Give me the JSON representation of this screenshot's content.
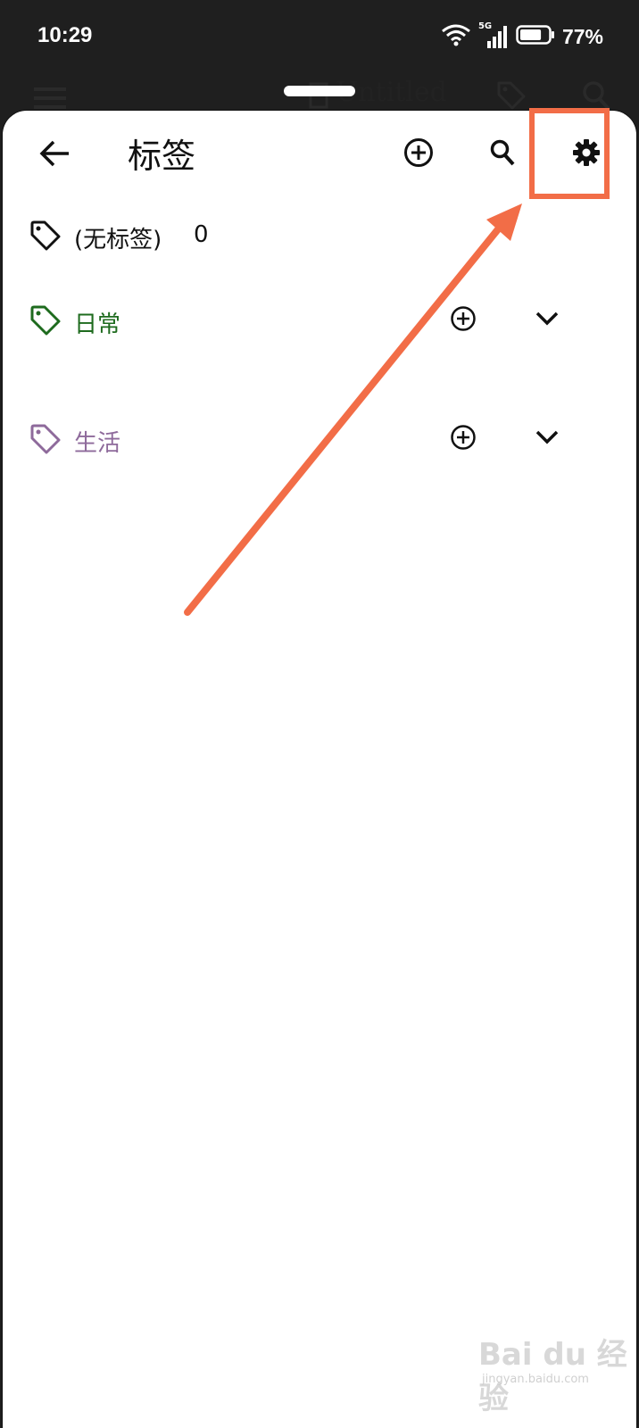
{
  "status_bar": {
    "time": "10:29",
    "network": "5G",
    "battery_percent": "77%",
    "battery_level": 0.77,
    "icons": [
      "wifi-icon",
      "signal-icon",
      "battery-icon"
    ]
  },
  "background_app_bar": {
    "title": "Untitled",
    "icons": [
      "menu-icon",
      "document-icon",
      "tag-icon",
      "search-icon"
    ]
  },
  "header": {
    "title": "标签",
    "icons": [
      "back-arrow-icon",
      "add-circle-icon",
      "search-icon",
      "settings-gear-icon"
    ]
  },
  "tags": [
    {
      "label": "(无标签)",
      "count": "0",
      "color": "#111111",
      "has_actions": false
    },
    {
      "label": "日常",
      "color": "#1e6b1e",
      "has_actions": true
    },
    {
      "label": "生活",
      "color": "#8e6a9b",
      "has_actions": true
    }
  ],
  "annotation": {
    "accent_color": "#f26d47",
    "target": "settings-button"
  },
  "watermark": {
    "text": "Bai du 经验",
    "subtext": "jingyan.baidu.com"
  }
}
